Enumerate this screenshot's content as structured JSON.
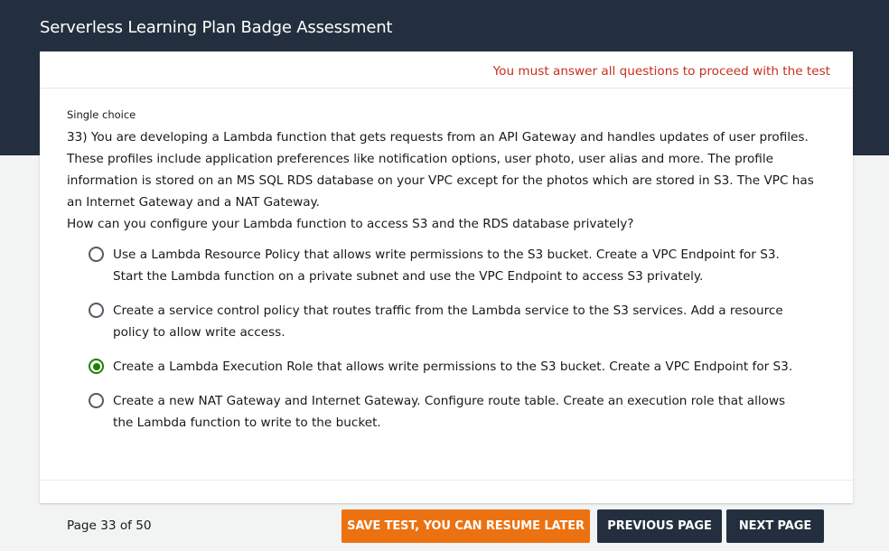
{
  "header": {
    "title": "Serverless Learning Plan Badge Assessment"
  },
  "warning": "You must answer all questions to proceed with the test",
  "question": {
    "type": "Single choice",
    "text": "33) You are developing a Lambda function that gets requests from an API Gateway and handles updates of user profiles. These profiles include application preferences like notification options, user photo, user alias and more. The profile information is stored on an MS SQL RDS database on your VPC except for the photos which are stored in S3. The VPC has an Internet Gateway and a NAT Gateway.",
    "prompt": "How can you configure your Lambda function to access S3 and the RDS database privately?",
    "options": [
      {
        "label": "Use a Lambda Resource Policy that allows write permissions to the S3 bucket. Create a VPC Endpoint for S3. Start the Lambda function on a private subnet and use the VPC Endpoint to access S3 privately.",
        "selected": false
      },
      {
        "label": "Create a service control policy that routes traffic from the Lambda service to the S3 services. Add a resource policy to allow write access.",
        "selected": false
      },
      {
        "label": "Create a Lambda Execution Role that allows write permissions to the S3 bucket. Create a VPC Endpoint for S3.",
        "selected": true
      },
      {
        "label": "Create a new NAT Gateway and Internet Gateway. Configure route table. Create an execution role that allows the Lambda function to write to the bucket.",
        "selected": false
      }
    ]
  },
  "footer": {
    "page_info": "Page 33 of 50",
    "save_label": "SAVE TEST, YOU CAN RESUME LATER",
    "prev_label": "PREVIOUS PAGE",
    "next_label": "NEXT PAGE"
  },
  "colors": {
    "header_bg": "#232f3e",
    "warning": "#c7301c",
    "selected_radio": "#1d8102",
    "save_button": "#ec7211",
    "nav_button": "#232f3e"
  }
}
